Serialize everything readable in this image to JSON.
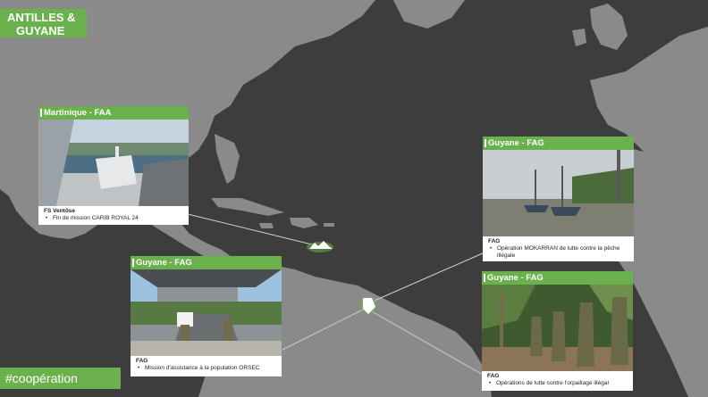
{
  "title": {
    "line1": "ANTILLES &",
    "line2": "GUYANE"
  },
  "hashtag": "#coopération",
  "colors": {
    "accent": "#6ab04c",
    "land": "#8a8a8a",
    "sea": "#3d3d3d"
  },
  "cards": {
    "martinique": {
      "header": "Martinique - FAA",
      "unit": "FS Ventôse",
      "bullet": "Fin de mission CARIB ROYAL 24"
    },
    "guyane_mokarran": {
      "header": "Guyane - FAG",
      "unit": "FAG",
      "bullet": "Opération MOKARRAN de lutte contre la pêche illégale"
    },
    "guyane_orsec": {
      "header": "Guyane - FAG",
      "unit": "FAG",
      "bullet": "Mission d'assistance à la population ORSEC"
    },
    "guyane_orpaillage": {
      "header": "Guyane - FAG",
      "unit": "FAG",
      "bullet": "Opérations de lutte contre l'orpaillage illégal"
    }
  },
  "markers": {
    "antilles": "antilles-marker",
    "guyane": "guyane-marker"
  }
}
